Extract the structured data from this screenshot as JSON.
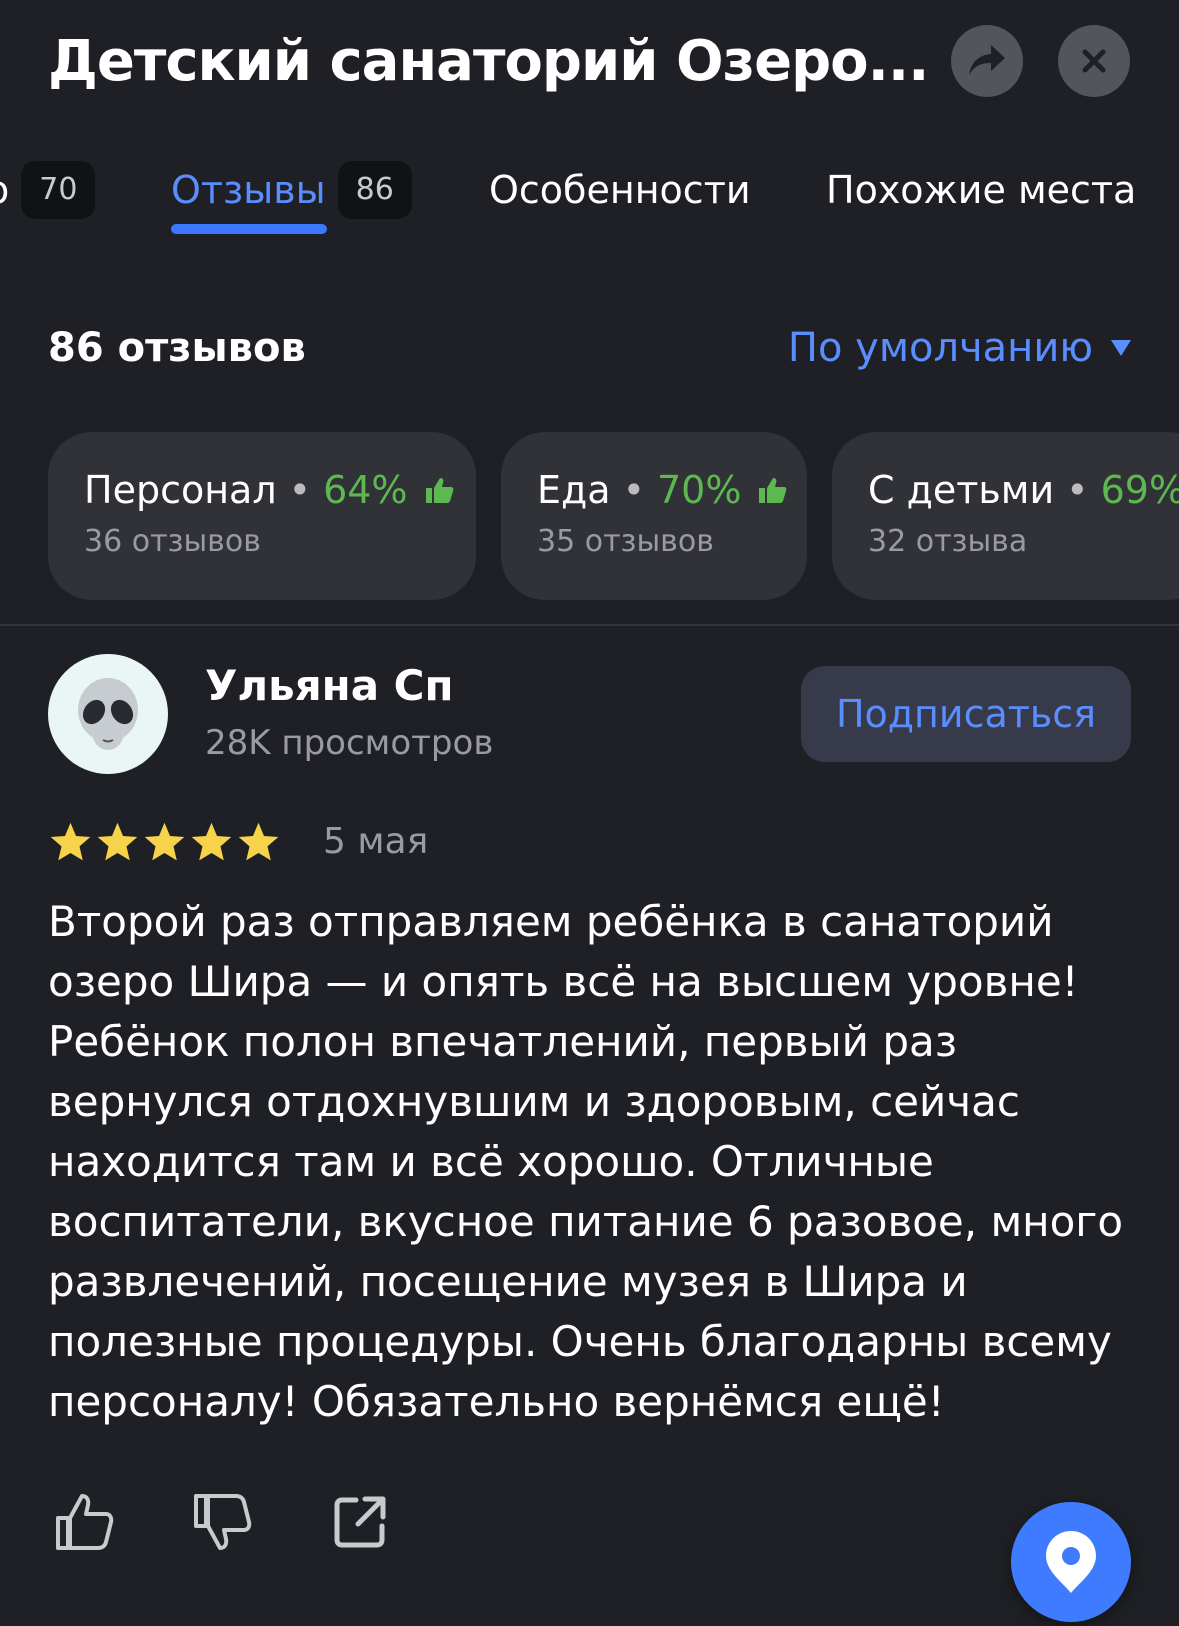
{
  "header": {
    "title": "Детский санаторий Озеро...",
    "share_icon": "share-arrow-icon",
    "close_icon": "close-icon"
  },
  "tabs": [
    {
      "label": "о",
      "count": "70",
      "active": false
    },
    {
      "label": "Отзывы",
      "count": "86",
      "active": true
    },
    {
      "label": "Особенности",
      "count": "",
      "active": false
    },
    {
      "label": "Похожие места",
      "count": "",
      "active": false
    }
  ],
  "reviews_header": {
    "count_label": "86 отзывов",
    "sort_label": "По умолчанию"
  },
  "aspects": [
    {
      "name": "Персонал",
      "percent": "64%",
      "sub": "36 отзывов"
    },
    {
      "name": "Еда",
      "percent": "70%",
      "sub": "35 отзывов"
    },
    {
      "name": "С детьми",
      "percent": "69%",
      "sub": "32 отзыва"
    }
  ],
  "review": {
    "author": "Ульяна Сп",
    "views": "28K просмотров",
    "avatar_emoji": "👽",
    "subscribe_label": "Подписаться",
    "rating": 5,
    "date": "5 мая",
    "text": "Второй раз отправляем ребёнка в санаторий озеро Шира — и опять всё на высшем уровне! Ребёнок полон впечатлений, первый раз вернулся отдохнувшим и здоровым, сейчас находится там и всё хорошо. Отличные воспитатели, вкусное питание 6 разовое, много развлечений, посещение музея в Шира и полезные процедуры. Очень благодарны всему персоналу! Обязательно вернёмся ещё!"
  },
  "colors": {
    "background": "#1f2025",
    "accent": "#5a8dfd",
    "positive": "#5cb84f",
    "card": "#313238",
    "star": "#f6d34a",
    "fab": "#3f7bff"
  }
}
